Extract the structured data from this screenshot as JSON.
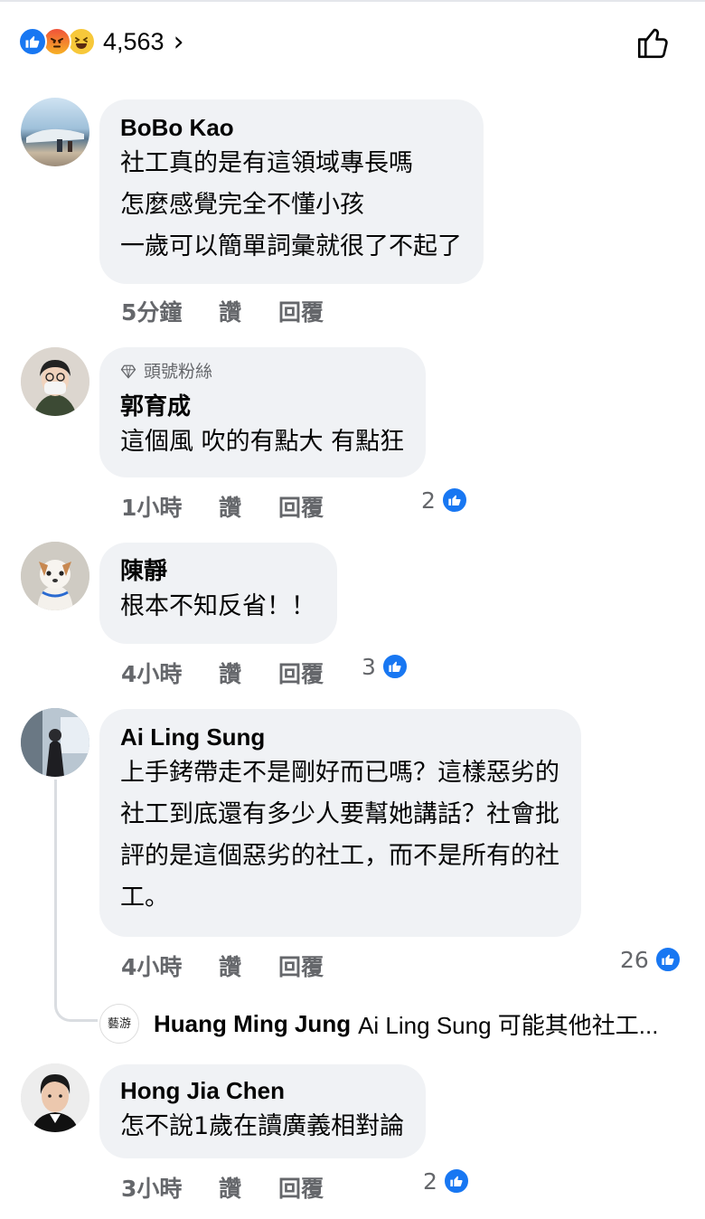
{
  "reactions": {
    "count": "4,563",
    "icons": [
      "like-icon",
      "angry-icon",
      "haha-icon"
    ],
    "chevron": "›"
  },
  "actions": {
    "like_icon": "thumbs-up-outline-icon"
  },
  "comments": [
    {
      "author": "BoBo Kao",
      "lines": [
        "社工真的是有這領域專長嗎",
        "怎麼感覺完全不懂小孩",
        "一歲可以簡單詞彙就很了不起了"
      ],
      "time": "5分鐘",
      "like_label": "讚",
      "reply_label": "回覆"
    },
    {
      "badge": "頭號粉絲",
      "author": "郭育成",
      "lines": [
        "這個風 吹的有點大 有點狂"
      ],
      "time": "1小時",
      "like_label": "讚",
      "reply_label": "回覆",
      "reactions": "2"
    },
    {
      "author": "陳靜",
      "lines": [
        "根本不知反省！！"
      ],
      "time": "4小時",
      "like_label": "讚",
      "reply_label": "回覆",
      "reactions": "3"
    },
    {
      "author": "Ai Ling Sung",
      "lines": [
        "上手銬帶走不是剛好而已嗎？這樣惡劣的",
        "社工到底還有多少人要幫她講話？社會批",
        "評的是這個惡劣的社工，而不是所有的社",
        "工。"
      ],
      "time": "4小時",
      "like_label": "讚",
      "reply_label": "回覆",
      "reactions": "26",
      "reply_preview": {
        "avatar_text": "藝游",
        "author": "Huang Ming Jung",
        "snippet": "Ai Ling Sung 可能其他社工..."
      }
    },
    {
      "author": "Hong Jia Chen",
      "lines": [
        "怎不說1歲在讀廣義相對論"
      ],
      "time": "3小時",
      "like_label": "讚",
      "reply_label": "回覆",
      "reactions": "2"
    }
  ],
  "colors": {
    "accent": "#1877f2",
    "bubble": "#f0f2f5",
    "meta": "#65676b"
  }
}
